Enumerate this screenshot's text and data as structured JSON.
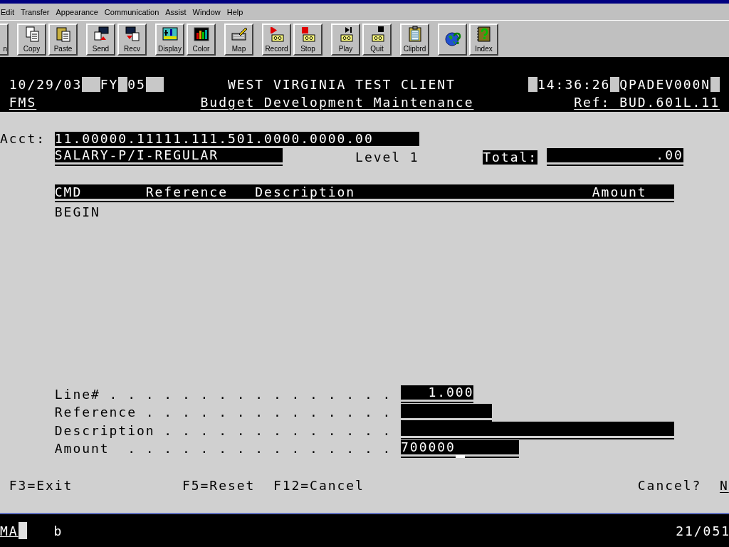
{
  "menu": [
    "Edit",
    "Transfer",
    "Appearance",
    "Communication",
    "Assist",
    "Window",
    "Help"
  ],
  "toolbar": [
    [
      {
        "kind": "labeled",
        "label": "n"
      }
    ],
    [
      {
        "kind": "labeled",
        "label": "Copy"
      },
      {
        "kind": "labeled",
        "label": "Paste"
      }
    ],
    [
      {
        "kind": "labeled",
        "label": "Send"
      },
      {
        "kind": "labeled",
        "label": "Recv"
      }
    ],
    [
      {
        "kind": "labeled",
        "label": "Display"
      },
      {
        "kind": "labeled",
        "label": "Color"
      }
    ],
    [
      {
        "kind": "labeled",
        "label": "Map"
      }
    ],
    [
      {
        "kind": "labeled",
        "label": "Record"
      },
      {
        "kind": "labeled",
        "label": "Stop"
      }
    ],
    [
      {
        "kind": "labeled",
        "label": "Play"
      },
      {
        "kind": "labeled",
        "label": "Quit"
      }
    ],
    [
      {
        "kind": "labeled",
        "label": "Clipbrd"
      }
    ],
    [
      {
        "kind": "icon_only"
      },
      {
        "kind": "labeled",
        "label": "Index"
      }
    ]
  ],
  "header": {
    "date": "10/29/03",
    "fy_label": "FY",
    "fy": "05",
    "client": "WEST VIRGINIA TEST CLIENT",
    "time": "14:36:26",
    "device": "QPADEV000N",
    "system": "FMS",
    "title": "Budget Development Maintenance",
    "ref": "Ref: BUD.601L.11"
  },
  "account": {
    "label": "Acct:",
    "number": "11.00000.11111.111.501.0000.0000.00",
    "description": "SALARY-P/I-REGULAR",
    "level": "Level 1",
    "total_label": "Total:",
    "total": ".00"
  },
  "table": {
    "columns": [
      "CMD",
      "Reference",
      "Description",
      "Amount"
    ],
    "rows": [
      {
        "cmd": "BEGIN"
      }
    ]
  },
  "form": [
    {
      "label": "Line# . . . . . . . . . . . . . . . .",
      "value": "1.000"
    },
    {
      "label": "Reference . . . . . . . . . . . . . ."
    },
    {
      "label": "Description . . . . . . . . . . . . ."
    },
    {
      "label": "Amount  . . . . . . . . . . . . . . .",
      "value": "700000"
    }
  ],
  "function_keys": [
    "F3=Exit",
    "F5=Reset",
    "F12=Cancel"
  ],
  "cancel": {
    "label": "Cancel?",
    "value": "N"
  },
  "status_bar": {
    "mode": "MA",
    "indicator": "b",
    "position": "21/051"
  }
}
